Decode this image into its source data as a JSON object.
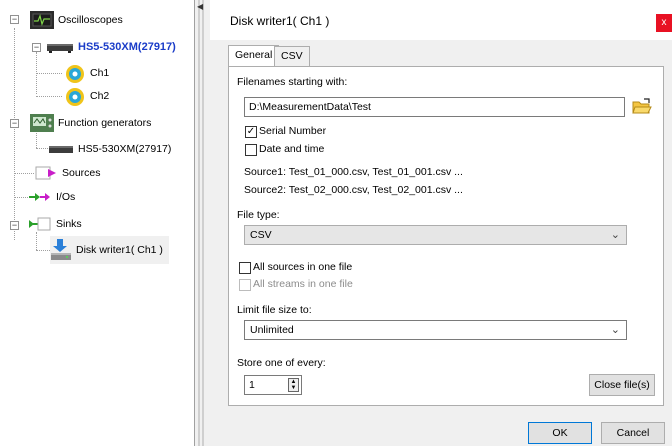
{
  "tree": {
    "oscilloscopes": "Oscilloscopes",
    "scope_device": "HS5-530XM(27917)",
    "ch1": "Ch1",
    "ch2": "Ch2",
    "function_generators": "Function generators",
    "gen_device": "HS5-530XM(27917)",
    "sources": "Sources",
    "ios": "I/Os",
    "sinks": "Sinks",
    "disk_writer": "Disk writer1( Ch1 )"
  },
  "window": {
    "title": "Disk writer1( Ch1 )",
    "close_glyph": "x",
    "tabs": [
      "General",
      "CSV"
    ]
  },
  "general": {
    "filenames_label": "Filenames starting with:",
    "filename_value": "D:\\MeasurementData\\Test",
    "serial_number_label": "Serial Number",
    "serial_number_checked": true,
    "date_time_label": "Date and time",
    "date_time_checked": false,
    "source1_preview": "Source1: Test_01_000.csv, Test_01_001.csv ...",
    "source2_preview": "Source2: Test_02_000.csv, Test_02_001.csv ...",
    "file_type_label": "File type:",
    "file_type_value": "CSV",
    "all_sources_label": "All sources in one file",
    "all_sources_checked": false,
    "all_streams_label": "All streams in one file",
    "all_streams_checked": false,
    "limit_label": "Limit file size to:",
    "limit_value": "Unlimited",
    "store_label": "Store one of every:",
    "store_value": "1",
    "close_files_label": "Close file(s)"
  },
  "buttons": {
    "ok": "OK",
    "cancel": "Cancel"
  },
  "colors": {
    "device_blue": "#1a3cc8",
    "close_red": "#e81123",
    "ok_border": "#0078d7"
  }
}
